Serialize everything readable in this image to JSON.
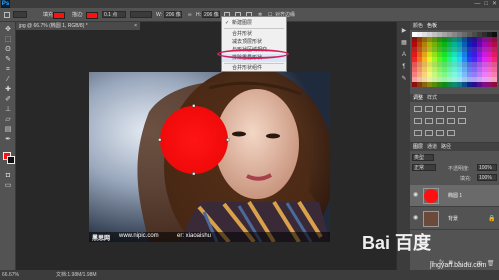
{
  "menubar": {
    "logo": "Ps",
    "window_controls": [
      "—",
      "□",
      "✕"
    ]
  },
  "optionsbar": {
    "fill_label": "填充:",
    "stroke_label": "描边:",
    "stroke_width": "0.1 点",
    "w_label": "W:",
    "w_value": "206 像",
    "h_label": "H:",
    "h_value": "206 像",
    "align_edges": "对齐边缘",
    "fill_color": "#ff1010",
    "stroke_color": "#ff1010"
  },
  "doctab": {
    "title": "jpg @ 66.7% (椭圆 1, RGB/8) *",
    "close": "×"
  },
  "context_menu": {
    "items": [
      {
        "label": "新建图层",
        "checked": true
      },
      {
        "label": "合并形状",
        "checked": false
      },
      {
        "label": "减去顶层形状",
        "checked": false
      },
      {
        "label": "与形状区域相交",
        "checked": false
      },
      {
        "label": "排除重叠形状",
        "checked": false
      },
      {
        "label": "合并形状组件",
        "checked": false
      }
    ]
  },
  "photo": {
    "watermark_left": "黑思网",
    "watermark_mid": "www.nipic.com",
    "watermark_right": "er: xiaoaishu",
    "circle_color": "#ff1010"
  },
  "panels": {
    "swatch_tabs": [
      "颜色",
      "色板"
    ],
    "adjust_tabs": [
      "调整",
      "样式"
    ],
    "layer_tabs": [
      "图层",
      "通道",
      "路径"
    ],
    "blend_mode": "正常",
    "opacity_label": "不透明度:",
    "opacity": "100%",
    "fill_label": "填充:",
    "fill": "100%",
    "filter_kind": "类型",
    "layers": [
      {
        "name": "椭圆 1",
        "thumb_color": "#ff1010"
      },
      {
        "name": "背景",
        "thumb_color": "#6b4a3a"
      }
    ]
  },
  "statusbar": {
    "zoom": "66.67%",
    "doc_info": "文档:1.98M/1.98M"
  },
  "watermark": {
    "baidu": "Bai  百度",
    "jingyan": "jingyan.baidu.com"
  }
}
